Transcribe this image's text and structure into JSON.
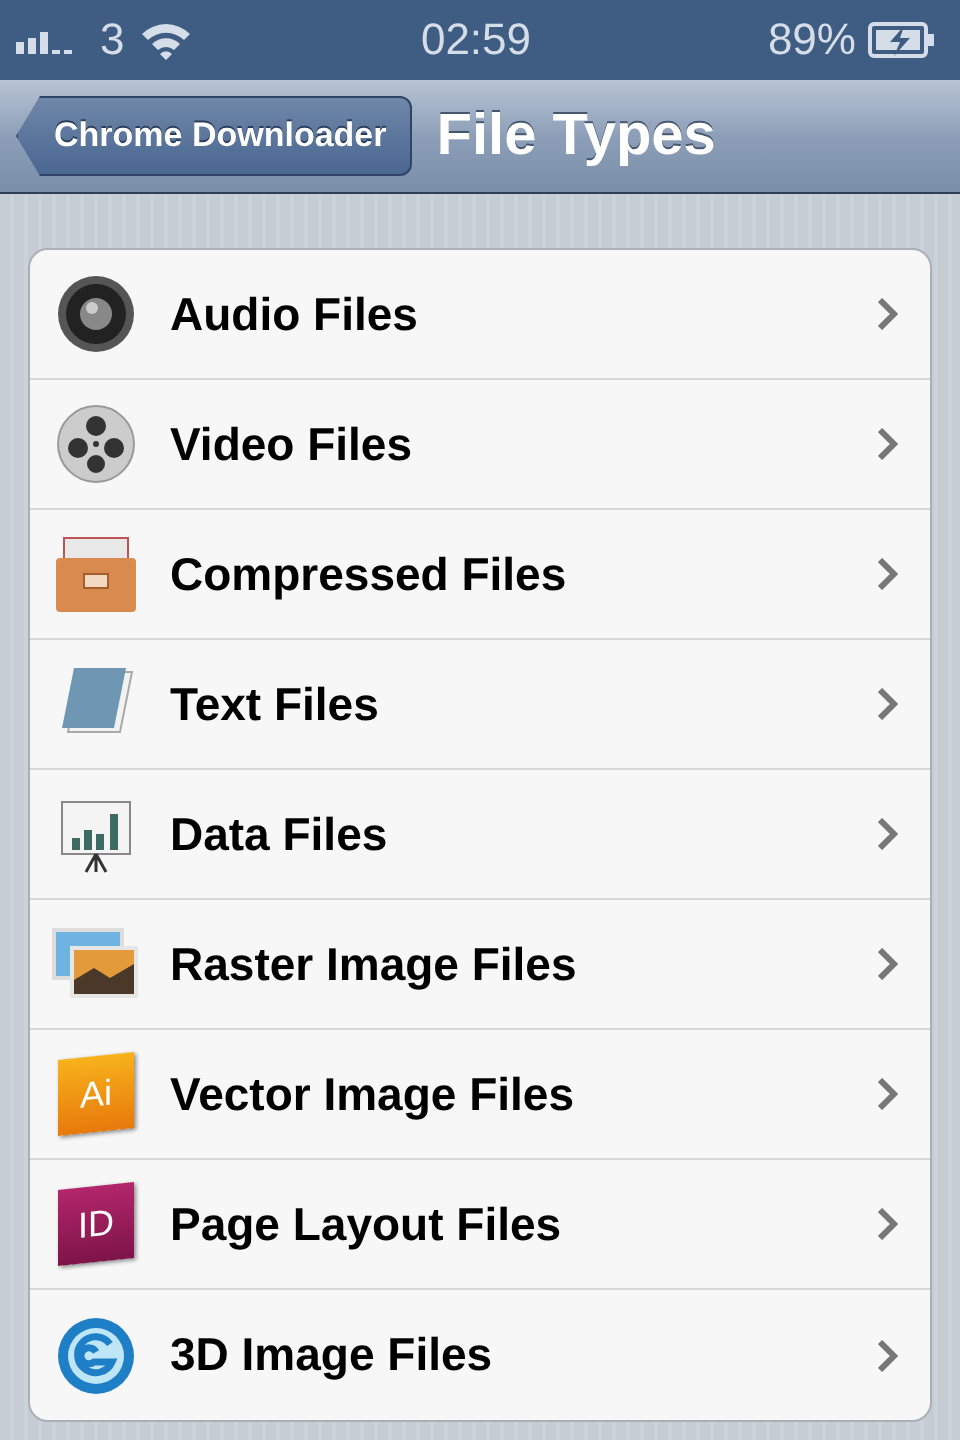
{
  "status_bar": {
    "carrier": "3",
    "time": "02:59",
    "battery": "89%"
  },
  "nav_bar": {
    "back": "Chrome Downloader",
    "title": "File Types"
  },
  "rows": [
    {
      "kind": "speaker",
      "label": "Audio Files"
    },
    {
      "kind": "film",
      "label": "Video Files"
    },
    {
      "kind": "drawer",
      "label": "Compressed Files"
    },
    {
      "kind": "notepad",
      "label": "Text Files"
    },
    {
      "kind": "chart",
      "label": "Data Files"
    },
    {
      "kind": "photo",
      "label": "Raster Image Files"
    },
    {
      "kind": "lettered",
      "icon_text": "Ai",
      "label": "Vector Image Files"
    },
    {
      "kind": "lettered",
      "icon_text": "ID",
      "label": "Page Layout Files"
    },
    {
      "kind": "swirl",
      "label": "3D Image Files"
    }
  ]
}
